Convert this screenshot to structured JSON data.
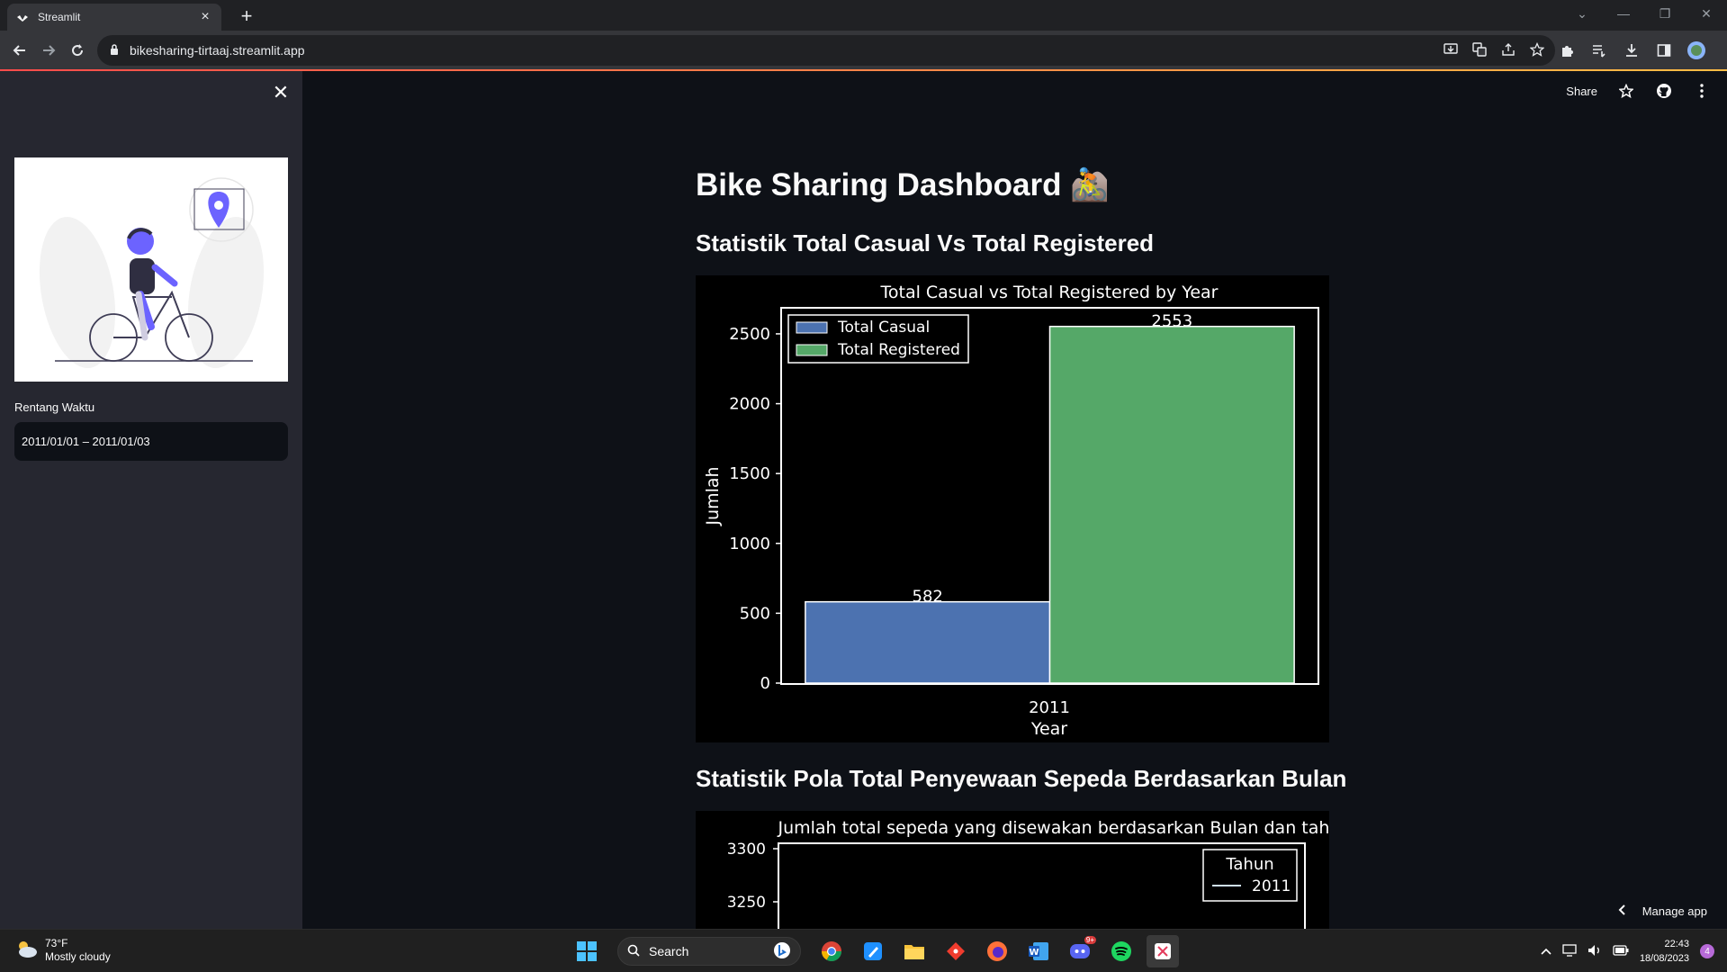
{
  "browser": {
    "tab_title": "Streamlit",
    "url": "bikesharing-tirtaaj.streamlit.app"
  },
  "sidebar": {
    "date_label": "Rentang Waktu",
    "date_value": "2011/01/01 – 2011/01/03"
  },
  "header": {
    "share_label": "Share"
  },
  "main": {
    "title": "Bike Sharing Dashboard 🚵",
    "section1": "Statistik Total Casual Vs Total Registered",
    "section2": "Statistik Pola Total Penyewaan Sepeda Berdasarkan Bulan",
    "manage_label": "Manage app"
  },
  "chart_data": [
    {
      "type": "bar",
      "title": "Total Casual vs Total Registered by Year",
      "xlabel": "Year",
      "ylabel": "Jumlah",
      "categories": [
        "2011"
      ],
      "series": [
        {
          "name": "Total Casual",
          "values": [
            582
          ],
          "color": "#4c72b0"
        },
        {
          "name": "Total Registered",
          "values": [
            2553
          ],
          "color": "#55a868"
        }
      ],
      "ylim": [
        0,
        2680
      ],
      "yticks": [
        0,
        500,
        1000,
        1500,
        2000,
        2500
      ],
      "data_labels": [
        "582",
        "2553"
      ],
      "legend": "top-left",
      "grid": false
    },
    {
      "type": "line",
      "title": "Jumlah total sepeda yang disewakan berdasarkan Bulan dan tahun",
      "legend_title": "Tahun",
      "series": [
        {
          "name": "2011",
          "values": []
        }
      ],
      "yticks": [
        3300,
        3250
      ],
      "legend": "top-right",
      "grid": false
    }
  ],
  "taskbar": {
    "weather_temp": "73°F",
    "weather_desc": "Mostly cloudy",
    "search_label": "Search",
    "time": "22:43",
    "date": "18/08/2023",
    "notification_count": "4",
    "discord_badge": "9+"
  }
}
